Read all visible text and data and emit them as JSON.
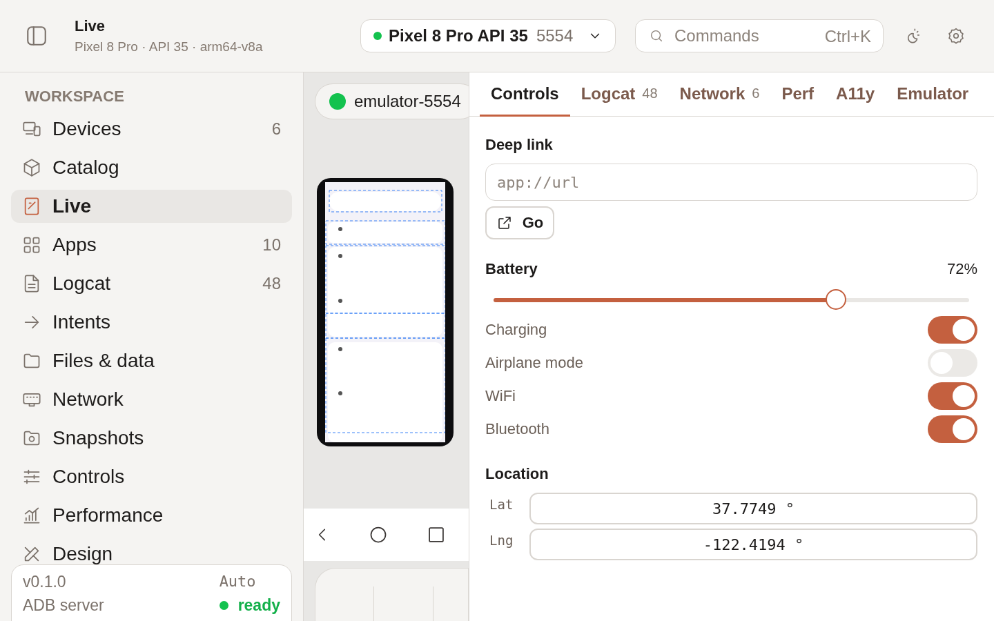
{
  "header": {
    "title": "Live",
    "subtitle": "Pixel 8 Pro · API 35 · arm64-v8a",
    "device_picker": {
      "connected": true,
      "name": "Pixel 8 Pro API 35",
      "port": "5554"
    },
    "command_search": {
      "placeholder": "Commands",
      "shortcut": "Ctrl+K"
    }
  },
  "sidebar": {
    "section": "WORKSPACE",
    "items": [
      {
        "label": "Devices",
        "count": "6",
        "selected": false
      },
      {
        "label": "Catalog",
        "selected": false
      },
      {
        "label": "Live",
        "selected": true
      },
      {
        "label": "Apps",
        "count": "10",
        "selected": false
      },
      {
        "label": "Logcat",
        "count": "48",
        "selected": false
      },
      {
        "label": "Intents",
        "selected": false
      },
      {
        "label": "Files & data",
        "selected": false
      },
      {
        "label": "Network",
        "selected": false
      },
      {
        "label": "Snapshots",
        "selected": false
      },
      {
        "label": "Controls",
        "selected": false
      },
      {
        "label": "Performance",
        "selected": false
      },
      {
        "label": "Design",
        "selected": false
      }
    ],
    "footer": {
      "version": "v0.1.0",
      "mode": "Auto",
      "server_label": "ADB server",
      "server_connected": true,
      "server_status": "ready"
    }
  },
  "device_pane": {
    "device_chip": {
      "label": "emulator-5554",
      "connected": true
    }
  },
  "panel": {
    "tabs": [
      {
        "label": "Controls",
        "selected": true
      },
      {
        "label": "Logcat",
        "count": "48",
        "selected": false
      },
      {
        "label": "Network",
        "count": "6",
        "selected": false
      },
      {
        "label": "Perf",
        "selected": false
      },
      {
        "label": "A11y",
        "selected": false
      },
      {
        "label": "Emulator",
        "selected": false
      }
    ],
    "deep_link": {
      "label": "Deep link",
      "placeholder": "app://url",
      "button": "Go"
    },
    "battery": {
      "label": "Battery",
      "reading": "72%",
      "level": 0.72
    },
    "toggles": [
      {
        "label": "Charging",
        "on": true
      },
      {
        "label": "Airplane mode",
        "on": false
      },
      {
        "label": "WiFi",
        "on": true
      },
      {
        "label": "Bluetooth",
        "on": true
      }
    ],
    "location": {
      "title": "Location",
      "fields": [
        {
          "label": "Lat",
          "value": "37.7749 °"
        },
        {
          "label": "Lng",
          "value": "-122.4194 °"
        }
      ]
    }
  }
}
